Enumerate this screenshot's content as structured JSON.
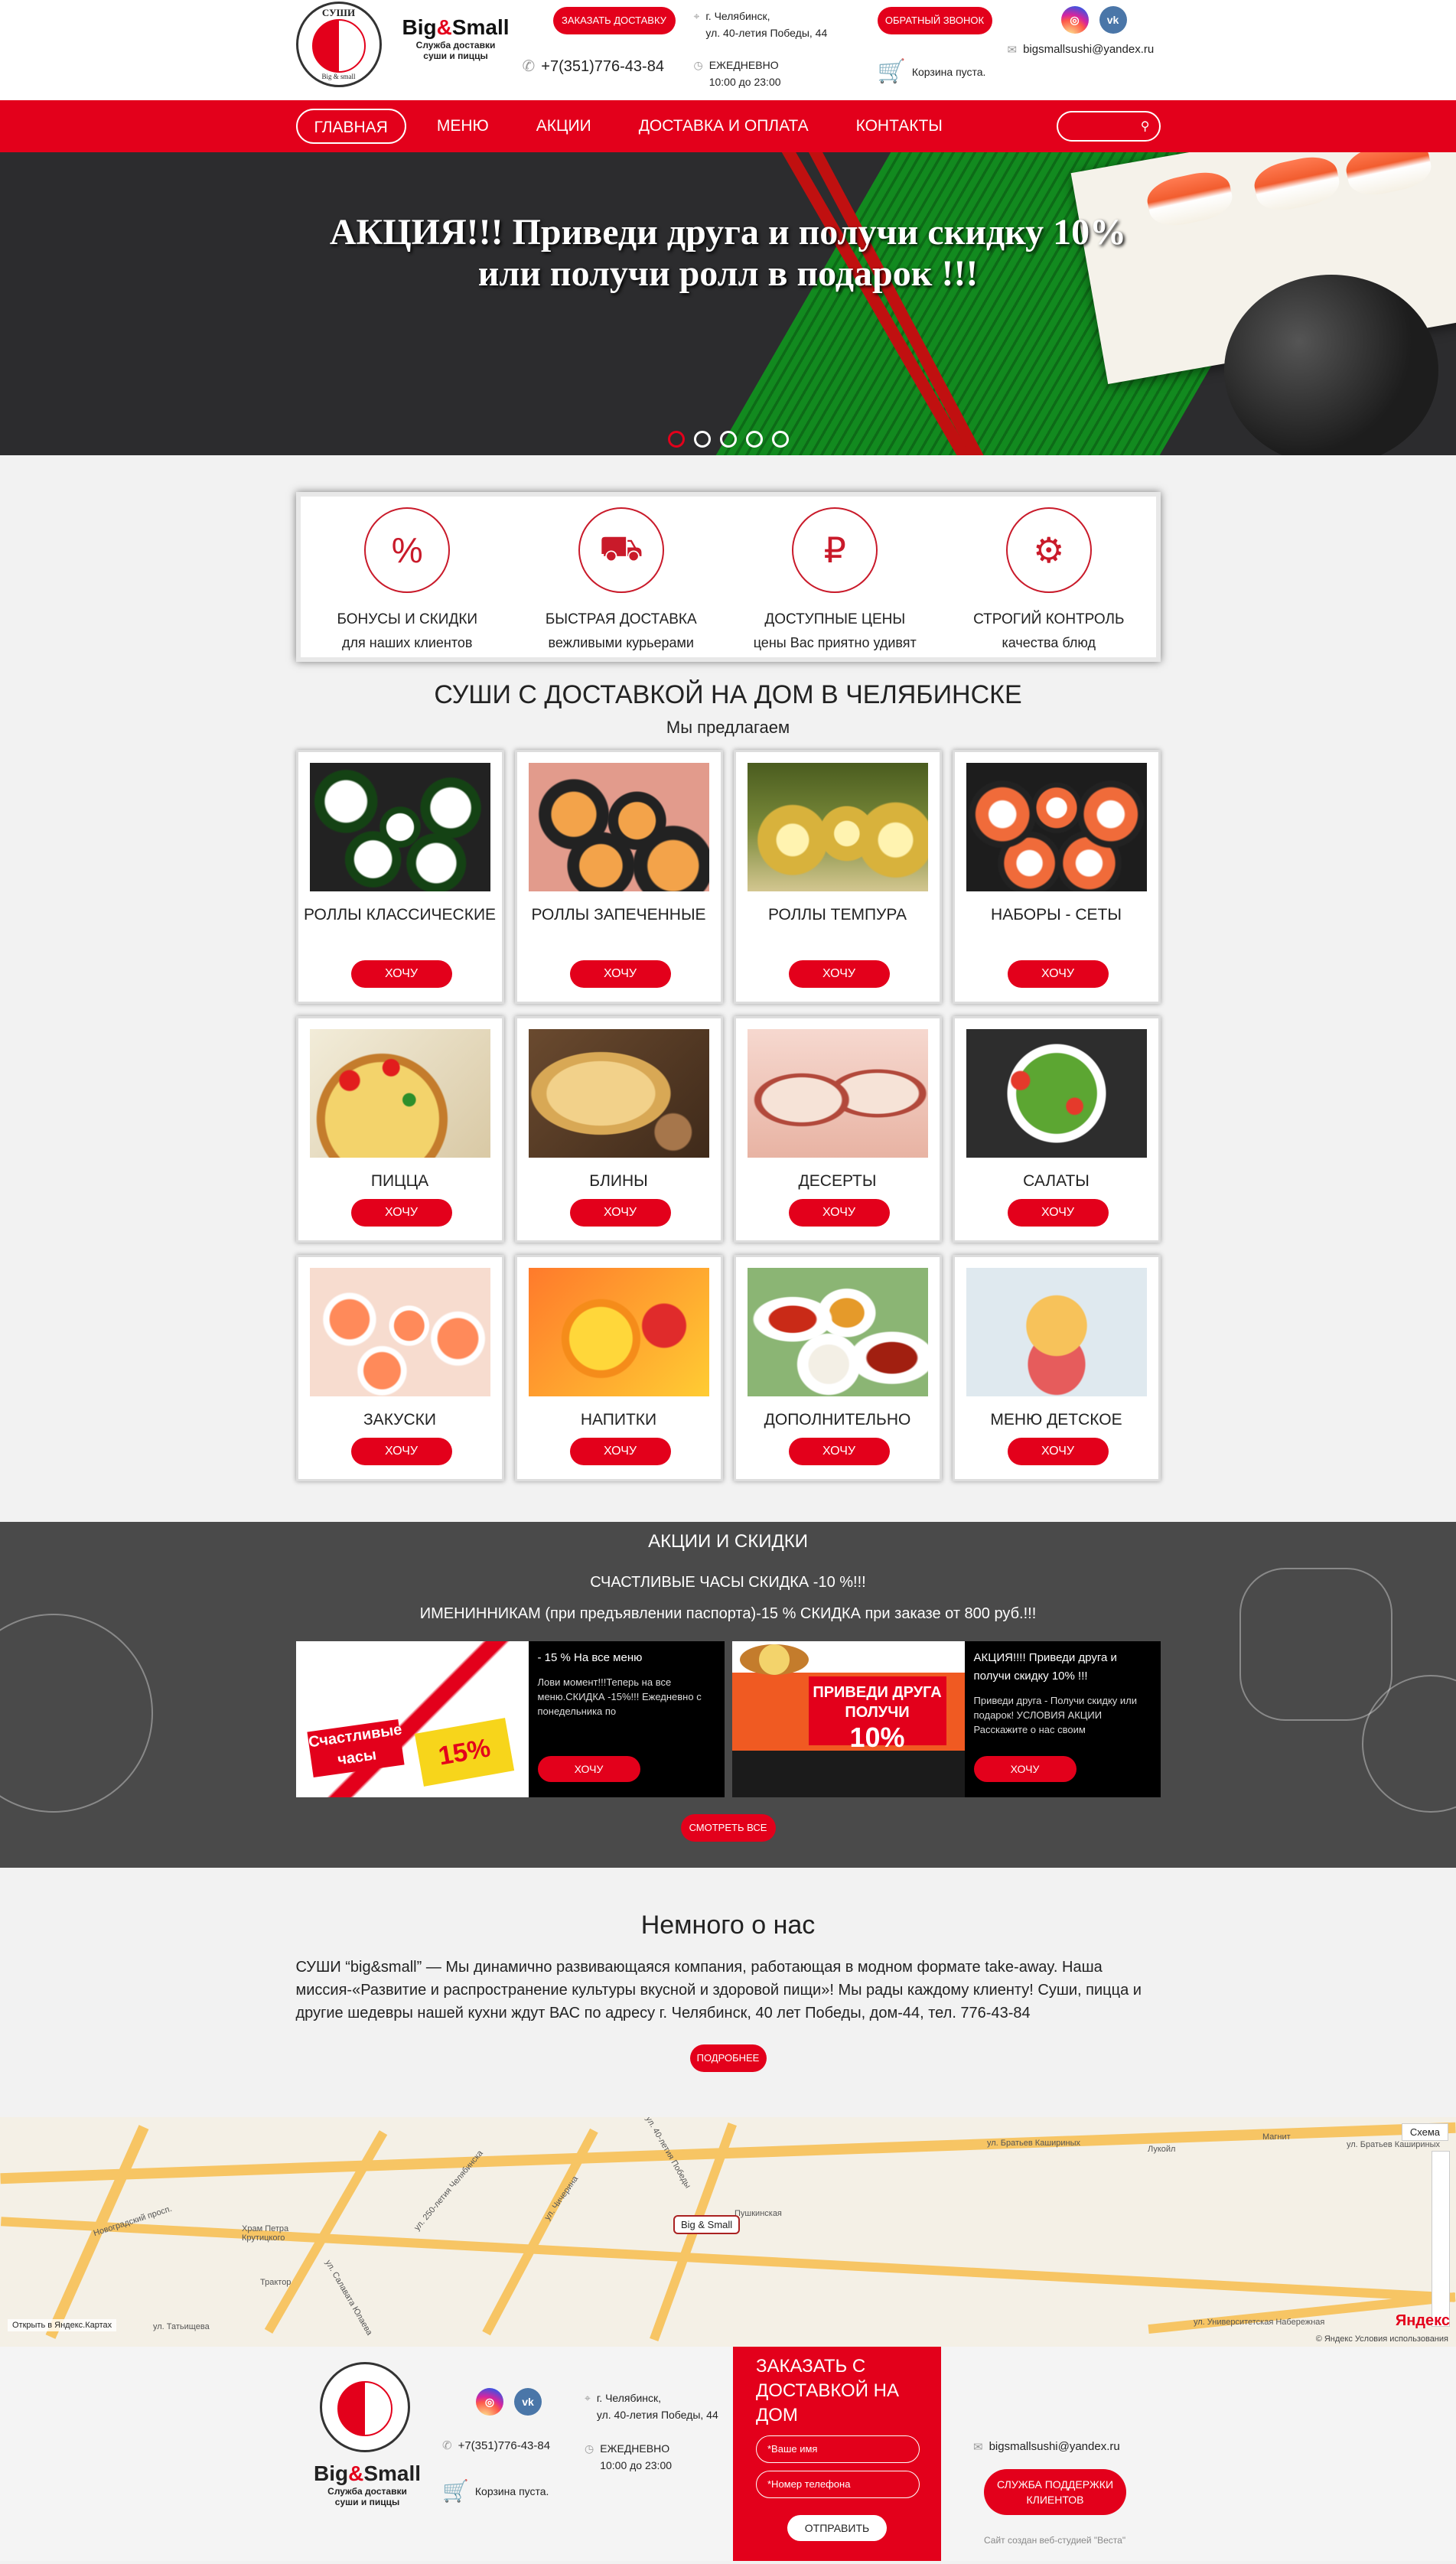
{
  "header": {
    "logo_text": "СУШИ",
    "logo_bottom": "Big & small",
    "brand_name": "Big",
    "brand_amp": "&",
    "brand_name2": "Small",
    "brand_sub1": "Служба доставки",
    "brand_sub2": "суши и пиццы",
    "order_button": "ЗАКАЗАТЬ ДОСТАВКУ",
    "callback_button": "ОБРАТНЫЙ ЗВОНОК",
    "phone": "+7(351)776-43-84",
    "address_city": "г. Челябинск,",
    "address_street": "ул. 40-летия Победы, 44",
    "hours_label": "ЕЖЕДНЕВНО",
    "hours_time": "10:00 до 23:00",
    "cart": "Корзина пуста.",
    "email": "bigsmallsushi@yandex.ru",
    "instagram_icon": "instagram-icon",
    "vk_icon": "vk-icon"
  },
  "nav": {
    "items": [
      "ГЛАВНАЯ",
      "МЕНЮ",
      "АКЦИИ",
      "ДОСТАВКА И ОПЛАТА",
      "КОНТАКТЫ"
    ],
    "active": "ГЛАВНАЯ"
  },
  "hero": {
    "line1": "АКЦИЯ!!! Приведи друга и получи скидку 10%",
    "line2": "или получи ролл в подарок !!!",
    "slides": 5,
    "active_slide": 1
  },
  "features": [
    {
      "title": "БОНУСЫ И СКИДКИ",
      "sub": "для наших клиентов",
      "icon": "discount-icon"
    },
    {
      "title": "БЫСТРАЯ ДОСТАВКА",
      "sub": "вежливыми курьерами",
      "icon": "delivery-truck-icon"
    },
    {
      "title": "ДОСТУПНЫЕ ЦЕНЫ",
      "sub": "цены Вас приятно удивят",
      "icon": "price-hand-icon"
    },
    {
      "title": "СТРОГИЙ КОНТРОЛЬ",
      "sub": "качества блюд",
      "icon": "quality-box-icon"
    }
  ],
  "catalog": {
    "title": "СУШИ С ДОСТАВКОЙ НА ДОМ В ЧЕЛЯБИНСКЕ",
    "subtitle": "Мы предлагаем",
    "button": "ХОЧУ",
    "items": [
      "РОЛЛЫ КЛАССИЧЕСКИЕ",
      "РОЛЛЫ ЗАПЕЧЕННЫЕ",
      "РОЛЛЫ ТЕМПУРА",
      "НАБОРЫ - СЕТЫ",
      "ПИЦЦА",
      "БЛИНЫ",
      "ДЕСЕРТЫ",
      "САЛАТЫ",
      "ЗАКУСКИ",
      "НАПИТКИ",
      "ДОПОЛНИТЕЛЬНО",
      "МЕНЮ ДЕТСКОЕ"
    ]
  },
  "promo": {
    "title": "АКЦИИ И СКИДКИ",
    "line1": "СЧАСТЛИВЫЕ ЧАСЫ СКИДКА -10 %!!!",
    "line2": "ИМЕНИННИКАМ  (при предъявлении паспорта)-15 % СКИДКА при заказе от 800 руб.!!!",
    "cards": [
      {
        "title": "- 15 % На все меню",
        "desc": "Лови момент!!!Теперь на все меню.СКИДКА -15%!!! Ежедневно с понедельника по",
        "img_a": "Счастливые часы",
        "img_b": "15%",
        "button": "ХОЧУ"
      },
      {
        "title": "АКЦИЯ!!!! Приведи друга и получи скидку 10% !!!",
        "desc": "Приведи друга - Получи скидку или подарок! УСЛОВИЯ АКЦИИ Расскажите о нас своим",
        "img_a": "ПРИВЕДИ ДРУГА ПОЛУЧИ",
        "img_b": "10%",
        "button": "ХОЧУ"
      }
    ],
    "all_button": "СМОТРЕТЬ ВСЕ"
  },
  "about": {
    "title": "Немного о нас",
    "text": "СУШИ “big&small” — Мы динамично развивающаяся компания, работающая в модном формате take-away. Наша миссия-«Развитие и распространение культуры вкусной и здоровой пищи»! Мы рады каждому клиенту! Суши, пицца и другие шедевры нашей кухни ждут ВАС по адресу г. Челябинск, 40 лет Победы, дом-44, тел. 776-43-84",
    "button": "ПОДРОБНЕЕ"
  },
  "map": {
    "pin": "Big & Small",
    "schema": "Схема",
    "open_link": "Открыть в Яндекс.Картах",
    "copyright": "© Яндекс  Условия использования",
    "logo": "Яндекс",
    "labels": [
      "ул. Братьев Кашириных",
      "Новоградский просп.",
      "ул. 250-летия Челябинска",
      "ул. Чичерина",
      "ул. Университетская Набережная",
      "ул. Татьищева",
      "ул. Салавата Юлаева",
      "ул. 40-летия Победы",
      "Лукойл",
      "Магнит",
      "Храм Петра Крутицкого",
      "Трактор",
      "Пушкинская"
    ]
  },
  "footer": {
    "brand_name": "Big",
    "brand_amp": "&",
    "brand_name2": "Small",
    "brand_sub1": "Служба доставки",
    "brand_sub2": "суши и пиццы",
    "logo_text": "СУШИ",
    "phone": "+7(351)776-43-84",
    "cart": "Корзина пуста.",
    "address_city": "г. Челябинск,",
    "address_street": "ул. 40-летия Победы, 44",
    "hours_label": "ЕЖЕДНЕВНО",
    "hours_time": "10:00 до 23:00",
    "form_title": "ЗАКАЗАТЬ С ДОСТАВКОЙ НА ДОМ",
    "name_placeholder": "*Ваше имя",
    "phone_placeholder": "*Номер телефона",
    "send": "ОТПРАВИТЬ",
    "email": "bigsmallsushi@yandex.ru",
    "support": "СЛУЖБА ПОДДЕРЖКИ КЛИЕНТОВ",
    "credit": "Сайт создан веб-студией \"Веста\""
  },
  "colors": {
    "accent": "#e3001b",
    "dark": "#4a4a4a"
  }
}
